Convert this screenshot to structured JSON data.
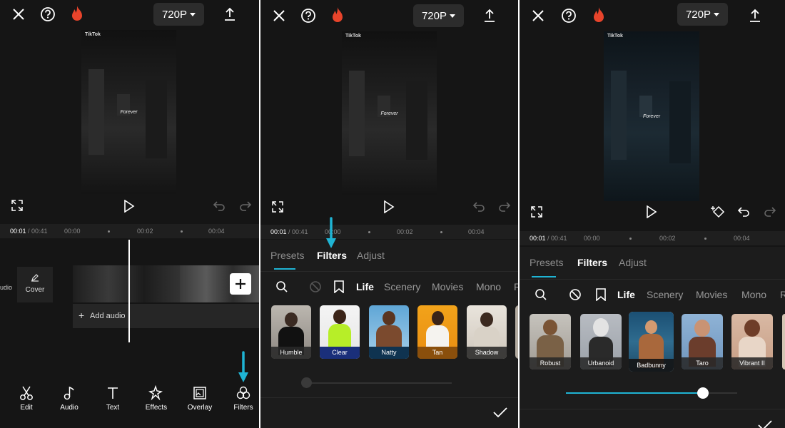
{
  "common": {
    "resolution": "720P",
    "tiktok": "TikTok",
    "caption": "Forever"
  },
  "panel1": {
    "timeline": {
      "current": "00:01",
      "total": " / 00:41",
      "t0": "00:00",
      "t2": "00:02",
      "t4": "00:04"
    },
    "audio_label": "udio",
    "cover_label": "Cover",
    "add_audio": "Add audio",
    "toolbar": [
      {
        "label": "Edit",
        "icon": "scissors-icon"
      },
      {
        "label": "Audio",
        "icon": "music-note-icon"
      },
      {
        "label": "Text",
        "icon": "text-icon"
      },
      {
        "label": "Effects",
        "icon": "sparkle-icon"
      },
      {
        "label": "Overlay",
        "icon": "overlay-icon"
      },
      {
        "label": "Filters",
        "icon": "filters-icon"
      }
    ]
  },
  "panel2": {
    "timeline": {
      "current": "00:01",
      "total": " / 00:41",
      "t0": "00:00",
      "t2": "00:02",
      "t4": "00:04"
    },
    "tabs": [
      "Presets",
      "Filters",
      "Adjust"
    ],
    "active_tab": "Filters",
    "categories": [
      "Life",
      "Scenery",
      "Movies",
      "Mono",
      "R"
    ],
    "active_category": "Life",
    "filters": [
      "Humble",
      "Clear",
      "Natty",
      "Tan",
      "Shadow"
    ]
  },
  "panel3": {
    "timeline": {
      "current": "00:01",
      "total": " / 00:41",
      "t0": "00:00",
      "t2": "00:02",
      "t4": "00:04"
    },
    "tabs": [
      "Presets",
      "Filters",
      "Adjust"
    ],
    "active_tab": "Filters",
    "categories": [
      "Life",
      "Scenery",
      "Movies",
      "Mono",
      "R"
    ],
    "active_category": "Life",
    "filters": [
      "Robust",
      "Urbanoid",
      "Badbunny",
      "Taro",
      "Vibrant II"
    ],
    "selected_filter": "Badbunny",
    "intensity": 0.8
  },
  "colors": {
    "accent": "#1fb4d4",
    "flame": "#e8442b",
    "background": "#151515"
  }
}
